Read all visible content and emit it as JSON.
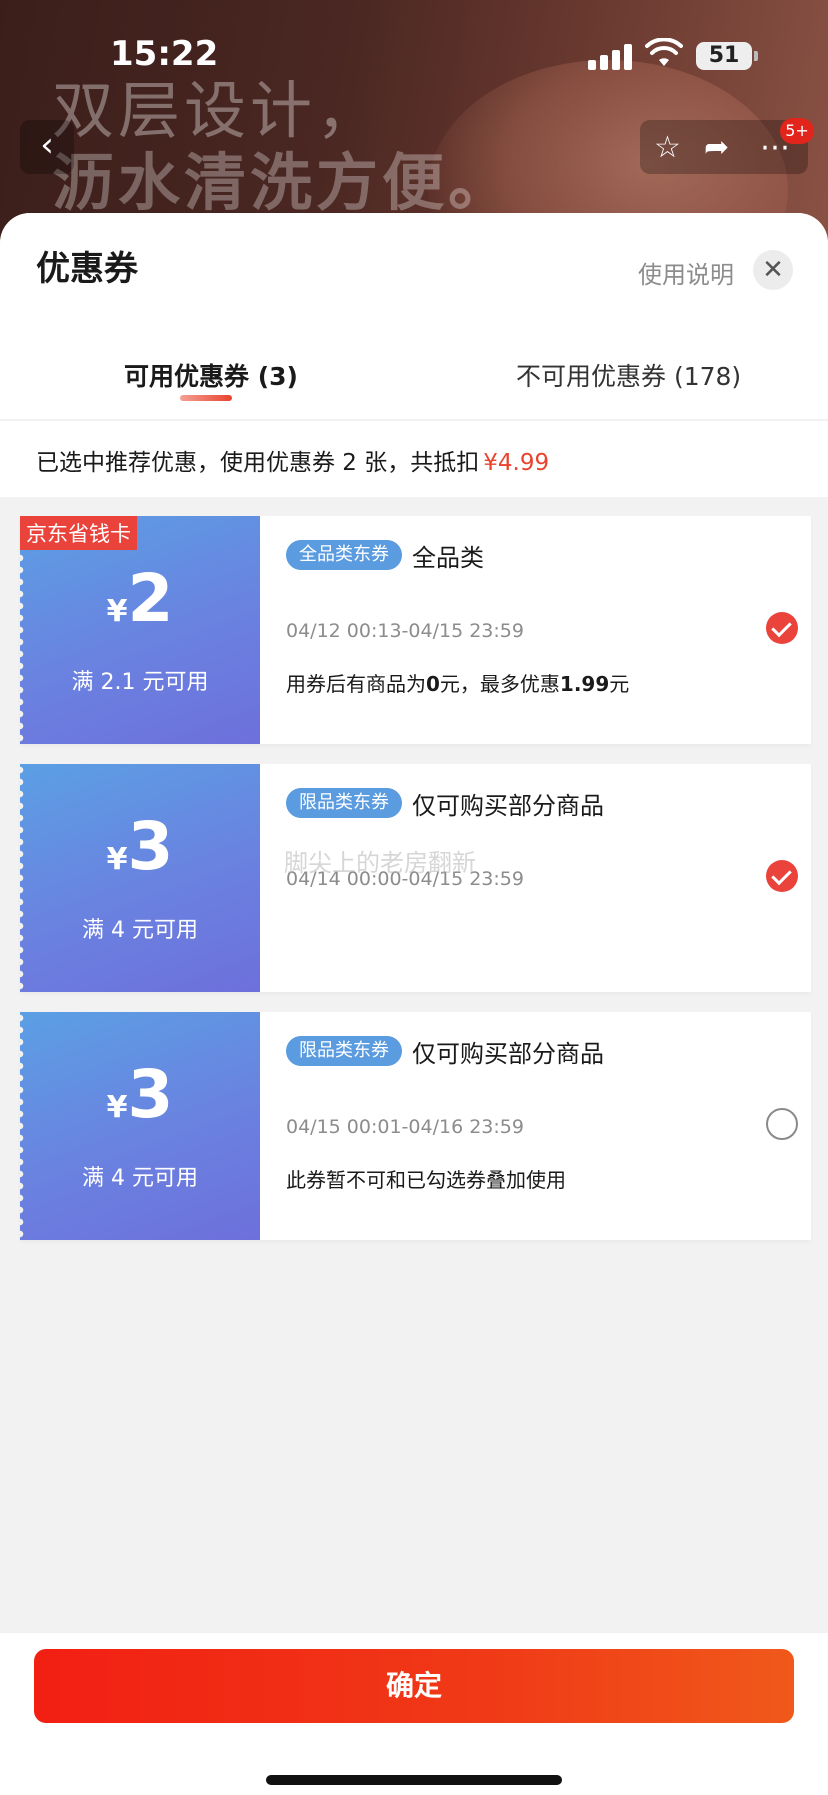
{
  "status_bar": {
    "time": "15:22",
    "battery": "51"
  },
  "background": {
    "line1": "双层设计，",
    "line2": "沥水清洗方便。"
  },
  "header_actions": {
    "notification_count": "5+"
  },
  "sheet": {
    "title": "优惠券",
    "help_label": "使用说明",
    "close_icon": "close-icon"
  },
  "tabs": [
    {
      "label": "可用优惠券 (3)",
      "active": true
    },
    {
      "label": "不可用优惠券 (178)",
      "active": false
    }
  ],
  "summary": {
    "text": "已选中推荐优惠，使用优惠券 2 张，共抵扣",
    "amount": "¥4.99"
  },
  "coupons": [
    {
      "badge": "京东省钱卡",
      "yen": "¥",
      "amount": "2",
      "condition": "满 2.1 元可用",
      "chip": "全品类东券",
      "name": "全品类",
      "validity": "04/12 00:13-04/15 23:59",
      "note_pre": "用券后有商品为",
      "note_bold1": "0",
      "note_mid": "元，最多优惠",
      "note_bold2": "1.99",
      "note_post": "元",
      "selected": true
    },
    {
      "yen": "¥",
      "amount": "3",
      "condition": "满 4 元可用",
      "chip": "限品类东券",
      "name": "仅可购买部分商品",
      "validity": "04/14 00:00-04/15 23:59",
      "selected": true
    },
    {
      "yen": "¥",
      "amount": "3",
      "condition": "满 4 元可用",
      "chip": "限品类东券",
      "name": "仅可购买部分商品",
      "validity": "04/15 00:01-04/16 23:59",
      "note": "此券暂不可和已勾选券叠加使用",
      "selected": false
    }
  ],
  "watermark": "脚尖上的老房翻新",
  "footer": {
    "confirm_label": "确定"
  },
  "colors": {
    "accent": "#e9432f",
    "coupon_blue": "#5b9be0",
    "confirm": "#f21f13"
  }
}
